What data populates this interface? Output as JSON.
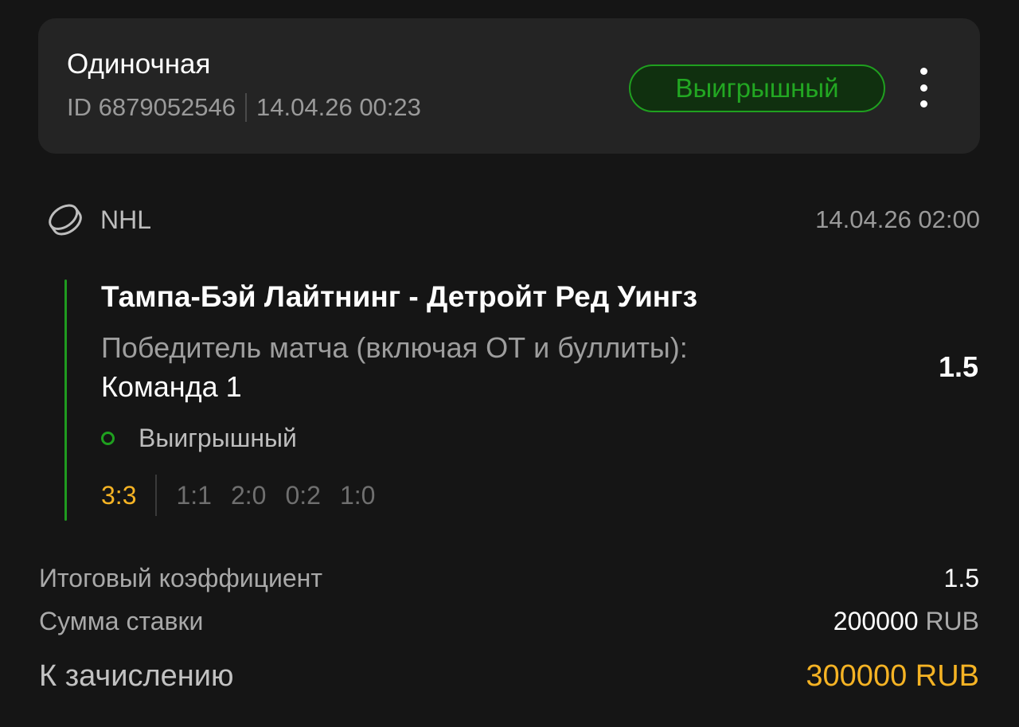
{
  "header": {
    "bet_type": "Одиночная",
    "bet_id": "ID 6879052546",
    "placed_at": "14.04.26 00:23",
    "status_badge": "Выигрышный",
    "status_color": "#22a722",
    "menu_icon": "more-vertical-icon"
  },
  "league": {
    "sport_icon": "hockey-puck-icon",
    "name": "NHL",
    "start_time": "14.04.26 02:00"
  },
  "event": {
    "match": "Тампа-Бэй Лайтнинг - Детройт Ред Уингз",
    "market": "Победитель матча (включая ОТ и буллиты):",
    "selection": "Команда 1",
    "odds": "1.5",
    "result_status": "Выигрышный",
    "score_total": "3:3",
    "score_periods": [
      "1:1",
      "2:0",
      "0:2",
      "1:0"
    ]
  },
  "summary": {
    "total_odds_label": "Итоговый коэффициент",
    "total_odds_value": "1.5",
    "stake_label": "Сумма ставки",
    "stake_amount": "200000",
    "stake_currency": "RUB",
    "payout_label": "К зачислению",
    "payout_value": "300000 RUB",
    "accent_color": "#f5b324"
  }
}
